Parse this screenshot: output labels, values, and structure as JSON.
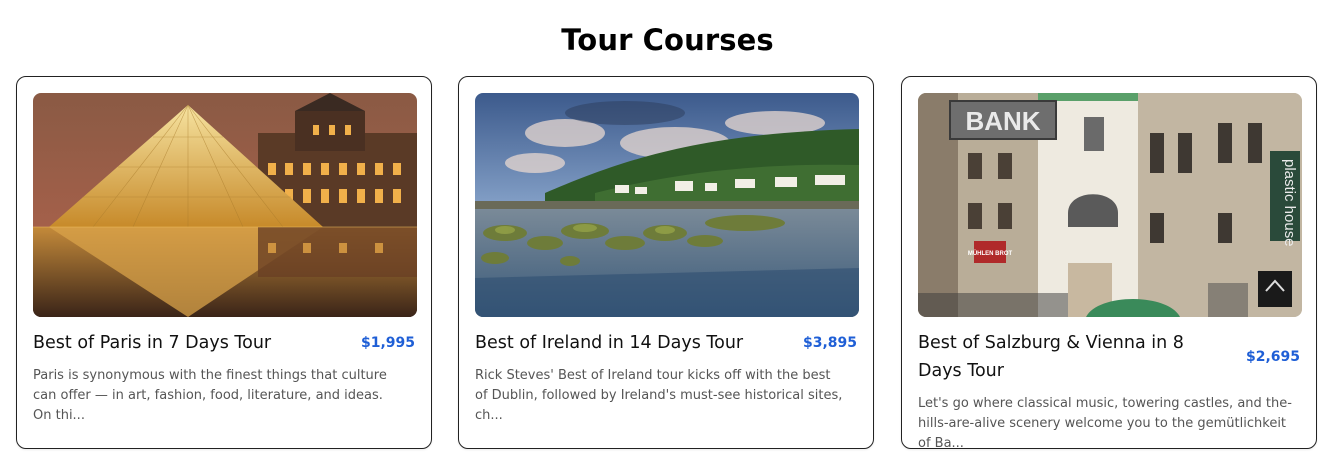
{
  "page": {
    "title": "Tour Courses"
  },
  "tours": [
    {
      "title": "Best of Paris in 7 Days Tour",
      "price": "$1,995",
      "description": "Paris is synonymous with the finest things that culture can offer — in art, fashion, food, literature, and ideas. On thi...",
      "image": "louvre-pyramid-photo"
    },
    {
      "title": "Best of Ireland in 14 Days Tour",
      "price": "$3,895",
      "description": "Rick Steves' Best of Ireland tour kicks off with the best of Dublin, followed by Ireland's must-see historical sites, ch...",
      "image": "irish-coast-photo"
    },
    {
      "title": "Best of Salzburg & Vienna in 8 Days Tour",
      "price": "$2,695",
      "description": "Let's go where classical music, towering castles, and the-hills-are-alive scenery welcome you to the gemütlichkeit of Ba...",
      "image": "vienna-street-photo",
      "image_text": {
        "sign_bank": "BANK",
        "sign_plastic": "plastic house",
        "sign_muhlen": "MÜHLEN BROT"
      }
    }
  ],
  "colors": {
    "price": "#1f5fd6",
    "card_border": "#222222"
  }
}
